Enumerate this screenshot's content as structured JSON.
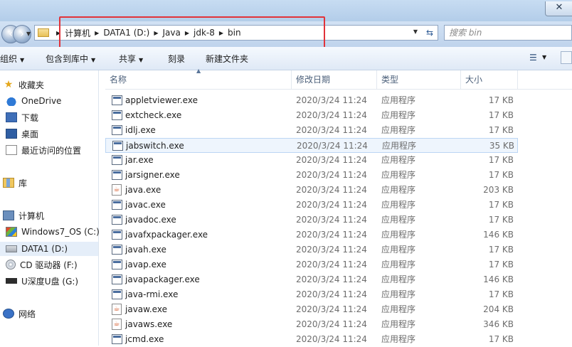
{
  "nav": {
    "breadcrumbs": [
      "计算机",
      "DATA1 (D:)",
      "Java",
      "jdk-8",
      "bin"
    ],
    "search_placeholder": "搜索 bin"
  },
  "toolbar": {
    "organize": "组织",
    "include_in_library": "包含到库中",
    "share": "共享",
    "burn": "刻录",
    "new_folder": "新建文件夹"
  },
  "sidebar": {
    "favorites": "收藏夹",
    "onedrive": "OneDrive",
    "downloads": "下载",
    "desktop": "桌面",
    "recent": "最近访问的位置",
    "libraries": "库",
    "computer": "计算机",
    "drive_c": "Windows7_OS (C:)",
    "drive_d": "DATA1 (D:)",
    "drive_f": "CD 驱动器 (F:)",
    "drive_g": "U深度U盘 (G:)",
    "network": "网络"
  },
  "columns": {
    "name": "名称",
    "date": "修改日期",
    "type": "类型",
    "size": "大小"
  },
  "files": [
    {
      "name": "appletviewer.exe",
      "date": "2020/3/24 11:24",
      "type": "应用程序",
      "size": "17 KB",
      "icon": "exe-icon"
    },
    {
      "name": "extcheck.exe",
      "date": "2020/3/24 11:24",
      "type": "应用程序",
      "size": "17 KB",
      "icon": "exe-icon"
    },
    {
      "name": "idlj.exe",
      "date": "2020/3/24 11:24",
      "type": "应用程序",
      "size": "17 KB",
      "icon": "exe-icon"
    },
    {
      "name": "jabswitch.exe",
      "date": "2020/3/24 11:24",
      "type": "应用程序",
      "size": "35 KB",
      "icon": "exe-icon"
    },
    {
      "name": "jar.exe",
      "date": "2020/3/24 11:24",
      "type": "应用程序",
      "size": "17 KB",
      "icon": "exe-icon"
    },
    {
      "name": "jarsigner.exe",
      "date": "2020/3/24 11:24",
      "type": "应用程序",
      "size": "17 KB",
      "icon": "exe-icon"
    },
    {
      "name": "java.exe",
      "date": "2020/3/24 11:24",
      "type": "应用程序",
      "size": "203 KB",
      "icon": "java-icon"
    },
    {
      "name": "javac.exe",
      "date": "2020/3/24 11:24",
      "type": "应用程序",
      "size": "17 KB",
      "icon": "exe-icon"
    },
    {
      "name": "javadoc.exe",
      "date": "2020/3/24 11:24",
      "type": "应用程序",
      "size": "17 KB",
      "icon": "exe-icon"
    },
    {
      "name": "javafxpackager.exe",
      "date": "2020/3/24 11:24",
      "type": "应用程序",
      "size": "146 KB",
      "icon": "exe-icon"
    },
    {
      "name": "javah.exe",
      "date": "2020/3/24 11:24",
      "type": "应用程序",
      "size": "17 KB",
      "icon": "exe-icon"
    },
    {
      "name": "javap.exe",
      "date": "2020/3/24 11:24",
      "type": "应用程序",
      "size": "17 KB",
      "icon": "exe-icon"
    },
    {
      "name": "javapackager.exe",
      "date": "2020/3/24 11:24",
      "type": "应用程序",
      "size": "146 KB",
      "icon": "exe-icon"
    },
    {
      "name": "java-rmi.exe",
      "date": "2020/3/24 11:24",
      "type": "应用程序",
      "size": "17 KB",
      "icon": "exe-icon"
    },
    {
      "name": "javaw.exe",
      "date": "2020/3/24 11:24",
      "type": "应用程序",
      "size": "204 KB",
      "icon": "java-icon"
    },
    {
      "name": "javaws.exe",
      "date": "2020/3/24 11:24",
      "type": "应用程序",
      "size": "346 KB",
      "icon": "java-icon"
    },
    {
      "name": "jcmd.exe",
      "date": "2020/3/24 11:24",
      "type": "应用程序",
      "size": "17 KB",
      "icon": "exe-icon"
    }
  ],
  "colors": {
    "annotation": "#e1333a",
    "selection": "#e5eef9"
  }
}
